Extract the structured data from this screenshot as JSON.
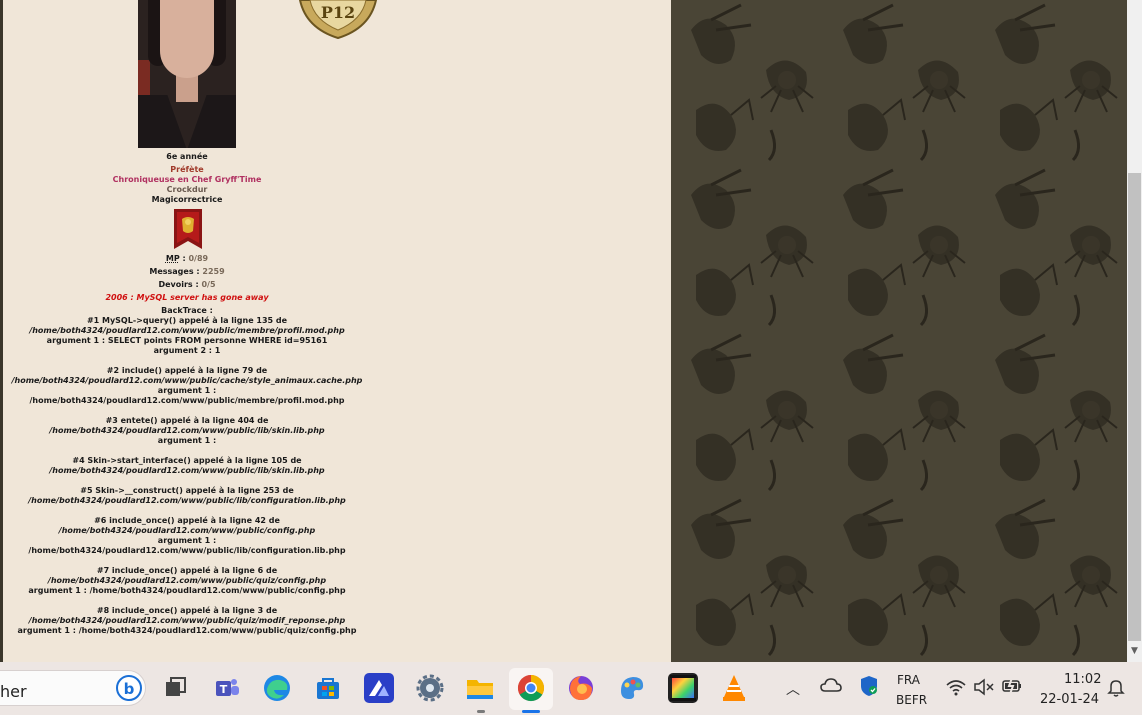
{
  "profile": {
    "year": "6e année",
    "roles": [
      "Préfète",
      "Chroniqueuse en Chef Gryff'Time",
      "Crockdur",
      "Magicorrectrice"
    ],
    "logo_text": "P12",
    "mp_label": "MP",
    "mp_value": "0/89",
    "messages_label": "Messages :",
    "messages_value": "2259",
    "devoirs_label": "Devoirs :",
    "devoirs_value": "0/5"
  },
  "error": {
    "message": "2006 : MySQL server has gone away",
    "backtrace_label": "BackTrace :",
    "frames": [
      {
        "line1": "#1 MySQL->query() appelé à la ligne 135 de",
        "file": "/home/both4324/poudlard12.com/www/public/membre/profil.mod.php",
        "args": [
          "argument 1 : SELECT points FROM personne WHERE id=95161",
          "argument 2 : 1"
        ]
      },
      {
        "line1": "#2 include() appelé à la ligne 79 de",
        "file": "/home/both4324/poudlard12.com/www/public/cache/style_animaux.cache.php",
        "args": [
          "argument 1 :",
          "/home/both4324/poudlard12.com/www/public/membre/profil.mod.php"
        ]
      },
      {
        "line1": "#3 entete() appelé à la ligne 404 de",
        "file": "/home/both4324/poudlard12.com/www/public/lib/skin.lib.php",
        "args": [
          "argument 1 :"
        ]
      },
      {
        "line1": "#4 Skin->start_interface() appelé à la ligne 105 de",
        "file": "/home/both4324/poudlard12.com/www/public/lib/skin.lib.php",
        "args": []
      },
      {
        "line1": "#5 Skin->__construct() appelé à la ligne 253 de",
        "file": "/home/both4324/poudlard12.com/www/public/lib/configuration.lib.php",
        "args": []
      },
      {
        "line1": "#6 include_once() appelé à la ligne 42 de",
        "file": "/home/both4324/poudlard12.com/www/public/config.php",
        "args": [
          "argument 1 :",
          "/home/both4324/poudlard12.com/www/public/lib/configuration.lib.php"
        ]
      },
      {
        "line1": "#7 include_once() appelé à la ligne 6 de",
        "file": "/home/both4324/poudlard12.com/www/public/quiz/config.php",
        "args": [
          "argument 1 : /home/both4324/poudlard12.com/www/public/config.php"
        ]
      },
      {
        "line1": "#8 include_once() appelé à la ligne 3 de",
        "file": "/home/both4324/poudlard12.com/www/public/quiz/modif_reponse.php",
        "args": [
          "argument 1 : /home/both4324/poudlard12.com/www/public/quiz/config.php"
        ]
      }
    ]
  },
  "taskbar": {
    "search_text": "her",
    "apps": [
      "task-view",
      "teams",
      "edge",
      "store",
      "affinity",
      "settings",
      "file-explorer",
      "chrome",
      "firefox",
      "paint",
      "photo",
      "vlc"
    ],
    "lang_top": "FRA",
    "lang_bottom": "BEFR",
    "time": "11:02",
    "date": "22-01-24"
  },
  "colors": {
    "page_bg": "#f0e6d8",
    "pattern_bg": "#4a4536",
    "error_red": "#d01010",
    "role_pink": "#b03060"
  }
}
